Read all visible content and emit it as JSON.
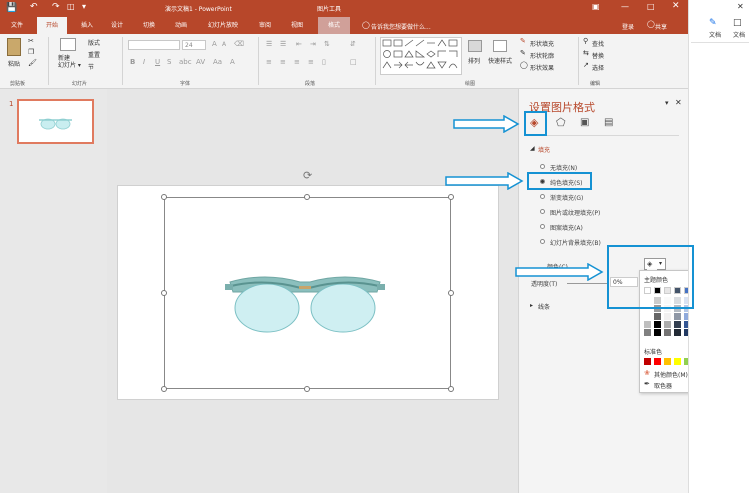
{
  "titlebar": {
    "doc_title": "演示文稿1 - PowerPoint",
    "context_tool": "图片工具",
    "login": "登录",
    "share": "共享"
  },
  "tabs": [
    "文件",
    "开始",
    "插入",
    "设计",
    "切换",
    "动画",
    "幻灯片放映",
    "审阅",
    "视图",
    "格式"
  ],
  "tell_me": "告诉我您想要做什么...",
  "ribbon": {
    "groups": [
      "剪贴板",
      "幻灯片",
      "字体",
      "段落",
      "绘图",
      "编辑"
    ],
    "paste": "粘贴",
    "new_slide": "新建\n幻灯片",
    "layout": "版式",
    "reset": "重置",
    "section": "节",
    "font_size": "24",
    "arrange": "排列",
    "quick_styles": "快速样式",
    "shape_fill": "形状填充",
    "shape_outline": "形状轮廓",
    "shape_effect": "形状效果",
    "find": "查找",
    "replace": "替换",
    "select": "选择"
  },
  "thumb": {
    "number": "1"
  },
  "panel": {
    "title": "设置图片格式",
    "fill_section": "填充",
    "options": [
      "无填充(N)",
      "纯色填充(S)",
      "渐变填充(G)",
      "图片或纹理填充(P)",
      "图案填充(A)",
      "幻灯片背景填充(B)"
    ],
    "selected_index": 1,
    "color_label": "颜色(C)",
    "transparency_label": "透明度(T)",
    "transparency_value": "0%",
    "line_section": "线条"
  },
  "color_popup": {
    "theme_colors_label": "主题颜色",
    "standard_colors_label": "标准色",
    "more_colors": "其他颜色(M)...",
    "eyedropper": "取色器",
    "theme_top": [
      "#ffffff",
      "#000000",
      "#e7e6e6",
      "#44546a",
      "#4472c4",
      "#ed7d31",
      "#a5a5a5",
      "#ffc000",
      "#5b9bd5",
      "#70ad47"
    ],
    "standard": [
      "#c00000",
      "#ff0000",
      "#ffc000",
      "#ffff00",
      "#92d050",
      "#00b050",
      "#00b0f0",
      "#0070c0",
      "#002060",
      "#7030a0"
    ]
  },
  "right_app": {
    "file_label": "文档",
    "file_label2": "文档"
  },
  "colors": {
    "accent": "#b7472a",
    "highlight": "#1592d3"
  }
}
